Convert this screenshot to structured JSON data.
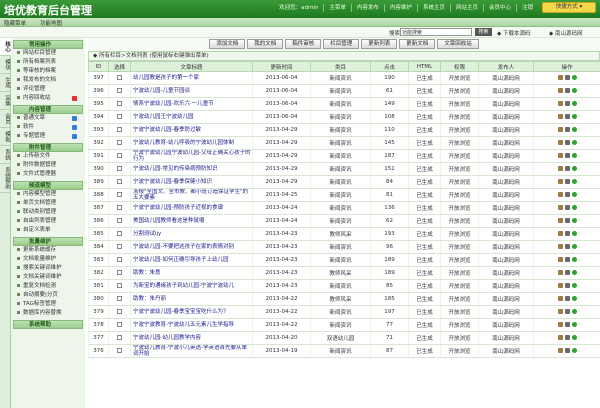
{
  "header": {
    "title": "培优教育后台管理",
    "nav": [
      "欢迎您：admin",
      "主菜单",
      "内容发布",
      "内容维护",
      "系统主页",
      "网站主页",
      "会员中心",
      "注销"
    ],
    "quick": "快捷方式 ▾"
  },
  "subbar": {
    "hide_menu": "隐藏菜单",
    "func_map": "功能地图"
  },
  "search": {
    "label": "搜索：",
    "placeholder": "",
    "value": "功能搜索",
    "button": "搜索",
    "download": "下载本源码",
    "goto": "南山源码网"
  },
  "sidebar": {
    "tabs": [
      "核心",
      "模块",
      "生成",
      "采集",
      "会员",
      "模板",
      "系统",
      "系统帮助"
    ],
    "groups": [
      {
        "title": "常用操作",
        "items": [
          "网站栏目管理",
          "所有档案列表",
          "等审核的档案",
          "我发布的文档",
          "评论管理",
          "内容回收站"
        ]
      },
      {
        "title": "内容管理",
        "items": [
          "普通文章",
          "软件",
          "专题管理"
        ]
      },
      {
        "title": "附件管理",
        "items": [
          "上传新文件",
          "附件数据管理",
          "文件式管理器"
        ]
      },
      {
        "title": "频道模型",
        "items": [
          "内容模型管理",
          "单页文档管理",
          "联动类别管理",
          "自由列表管理",
          "自定义表单"
        ]
      },
      {
        "title": "批量维护",
        "items": [
          "更新系统缓存",
          "文档批量维护",
          "搜索关键词维护",
          "文档关键词维护",
          "重复文档检测",
          "自动摘要|分页",
          "TAG标签管理",
          "数据库内容替换"
        ]
      },
      {
        "title": "系统帮助",
        "items": []
      }
    ]
  },
  "toolbar": {
    "buttons": [
      "添加文档",
      "我的文档",
      "稿件审核",
      "栏目管理",
      "更新列表",
      "更新文档",
      "文章回收站"
    ]
  },
  "breadcrumb": "◆ 所有栏目>文档列表  (使用鼠标右键弹出菜单)",
  "table": {
    "headers": [
      "ID",
      "选择",
      "文章标题",
      "更新时间",
      "类目",
      "点击",
      "HTML",
      "权限",
      "发布人",
      "操作"
    ],
    "rows": [
      [
        "397",
        "幼儿园教是孩子的第一个家",
        "2013-06-04",
        "新闻资讯",
        "190",
        "已生成",
        "开放浏览",
        "南山源码网"
      ],
      [
        "396",
        "宁波幼儿园-儿童节园谈",
        "2013-06-04",
        "新闻资讯",
        "61",
        "已生成",
        "开放浏览",
        "南山源码网"
      ],
      [
        "395",
        "情系宁波幼儿园-欢乐六·一儿童节",
        "2013-06-04",
        "新闻资讯",
        "149",
        "已生成",
        "开放浏览",
        "南山源码网"
      ],
      [
        "394",
        "宁波幼儿园王宁波幼儿园",
        "2013-06-04",
        "新闻资讯",
        "108",
        "已生成",
        "开放浏览",
        "南山源码网"
      ],
      [
        "393",
        "宁波宁波幼儿园-春季防过敏",
        "2013-04-29",
        "新闻资讯",
        "110",
        "已生成",
        "开放浏览",
        "南山源码网"
      ],
      [
        "392",
        "宁波幼儿教育-幼儿呼吸的宁波幼儿园体制",
        "2013-04-29",
        "新闻资讯",
        "145",
        "已生成",
        "开放浏览",
        "南山源码网"
      ],
      [
        "391",
        "宁波宁波幼儿园宁波幼儿园-父母正确关心孩子的行为",
        "2013-04-29",
        "新闻资讯",
        "187",
        "已生成",
        "开放浏览",
        "南山源码网"
      ],
      [
        "390",
        "宁波幼儿园-常见的传染病预防知识",
        "2013-04-29",
        "新闻资讯",
        "151",
        "已生成",
        "开放浏览",
        "南山源码网"
      ],
      [
        "389",
        "宁波宁波幼儿园-春季保健小知识",
        "2013-04-29",
        "新闻资讯",
        "84",
        "已生成",
        "开放浏览",
        "南山源码网"
      ],
      [
        "388",
        "浙报\"全国文、全市教、都小班订造保证学生\"的五大要素",
        "2013-04-25",
        "新闻资讯",
        "81",
        "已生成",
        "开放浏览",
        "南山源码网"
      ],
      [
        "387",
        "宁波宁波幼儿园-预防孩子近视的食谱",
        "2013-04-24",
        "新闻资讯",
        "136",
        "已生成",
        "开放浏览",
        "南山源码网"
      ],
      [
        "386",
        "美国幼儿园教师看这是种鼠嚼",
        "2013-04-24",
        "新闻资讯",
        "62",
        "已生成",
        "开放浏览",
        "南山源码网"
      ],
      [
        "385",
        "分割测试ijy",
        "2013-04-23",
        "教师风采",
        "193",
        "已生成",
        "开放浏览",
        "南山源码网"
      ],
      [
        "384",
        "宁波幼儿园-不要把这孩子在家的表情对别",
        "2013-04-23",
        "新闻资讯",
        "96",
        "已生成",
        "开放浏览",
        "南山源码网"
      ],
      [
        "383",
        "宁波幼儿园-如何正确引导孩子上幼儿园",
        "2013-04-23",
        "新闻资讯",
        "189",
        "已生成",
        "开放浏览",
        "南山源码网"
      ],
      [
        "382",
        "助教：朱意",
        "2013-04-23",
        "教师风采",
        "189",
        "已生成",
        "开放浏览",
        "南山源码网"
      ],
      [
        "381",
        "为新宝的通缘孩子到幼儿园-宁波宁波幼儿",
        "2013-04-23",
        "新闻资讯",
        "85",
        "已生成",
        "开放浏览",
        "南山源码网"
      ],
      [
        "380",
        "助教：朱丹丽",
        "2013-04-22",
        "教师风采",
        "185",
        "已生成",
        "开放浏览",
        "南山源码网"
      ],
      [
        "379",
        "宁波宁波幼儿园-春季宝宝宝吃什么为？",
        "2013-04-22",
        "新闻资讯",
        "197",
        "已生成",
        "开放浏览",
        "南山源码网"
      ],
      [
        "378",
        "宁波宁波教育-宁波幼儿五元素儿生学指导",
        "2013-04-22",
        "新闻资讯",
        "77",
        "已生成",
        "开放浏览",
        "南山源码网"
      ],
      [
        "377",
        "宁波幼儿园-幼儿园教学内容",
        "2013-04-20",
        "双语幼儿园",
        "71",
        "已生成",
        "开放浏览",
        "南山源码网"
      ],
      [
        "376",
        "宁波幼儿教育-宁波小儿英语-学英语首先要从单词开始",
        "2013-04-19",
        "新闻资讯",
        "87",
        "已生成",
        "开放浏览",
        "南山源码网"
      ]
    ]
  },
  "colors": {
    "header": "#2a8a2a",
    "accent": "#f6d84a"
  }
}
